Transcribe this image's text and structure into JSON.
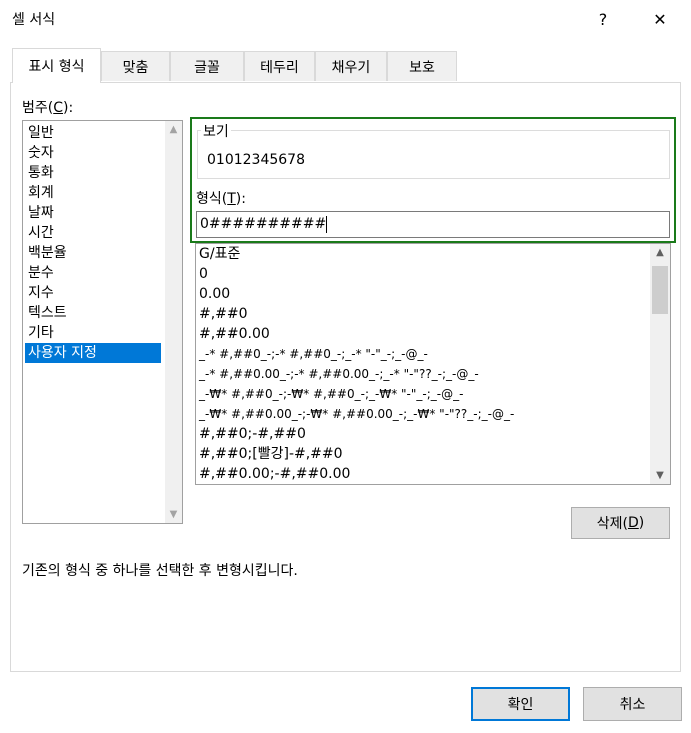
{
  "window": {
    "title": "셀 서식",
    "help_label": "?",
    "close_label": "✕"
  },
  "tabs": [
    {
      "label": "표시 형식",
      "active": true
    },
    {
      "label": "맞춤"
    },
    {
      "label": "글꼴"
    },
    {
      "label": "테두리"
    },
    {
      "label": "채우기"
    },
    {
      "label": "보호"
    }
  ],
  "category": {
    "label_prefix": "범주(",
    "label_key": "C",
    "label_suffix": "):",
    "items": [
      "일반",
      "숫자",
      "통화",
      "회계",
      "날짜",
      "시간",
      "백분율",
      "분수",
      "지수",
      "텍스트",
      "기타",
      "사용자 지정"
    ],
    "selected": "사용자 지정"
  },
  "preview": {
    "legend": "보기",
    "value": "01012345678"
  },
  "format": {
    "label_prefix": "형식(",
    "label_key": "T",
    "label_suffix": "):",
    "value": "0##########"
  },
  "type_list": [
    "G/표준",
    "0",
    "0.00",
    "#,##0",
    "#,##0.00",
    "_-* #,##0_-;-* #,##0_-;_-* \"-\"_-;_-@_-",
    "_-* #,##0.00_-;-* #,##0.00_-;_-* \"-\"??_-;_-@_-",
    "_-₩* #,##0_-;-₩* #,##0_-;_-₩* \"-\"_-;_-@_-",
    "_-₩* #,##0.00_-;-₩* #,##0.00_-;_-₩* \"-\"??_-;_-@_-",
    "#,##0;-#,##0",
    "#,##0;[빨강]-#,##0",
    "#,##0.00;-#,##0.00"
  ],
  "delete_button": {
    "prefix": "삭제(",
    "key": "D",
    "suffix": ")"
  },
  "description": "기존의 형식 중 하나를 선택한 후 변형시킵니다.",
  "ok_label": "확인",
  "cancel_label": "취소",
  "colors": {
    "selection": "#0078d7",
    "highlight_border": "#1a7a1a",
    "button_face": "#e1e1e1"
  },
  "icons": {
    "scroll_up": "▲",
    "scroll_down": "▼"
  }
}
